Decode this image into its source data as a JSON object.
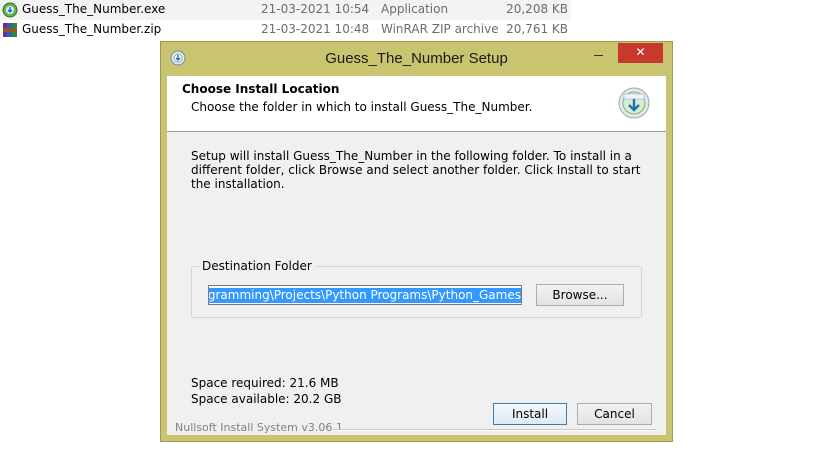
{
  "files": [
    {
      "name": "Guess_The_Number.exe",
      "date": "21-03-2021 10:54",
      "type": "Application",
      "size": "20,208 KB",
      "icon": "setup-app-icon"
    },
    {
      "name": "Guess_The_Number.zip",
      "date": "21-03-2021 10:48",
      "type": "WinRAR ZIP archive",
      "size": "20,761 KB",
      "icon": "winrar-archive-icon"
    }
  ],
  "window": {
    "title": "Guess_The_Number Setup",
    "close_glyph": "✕"
  },
  "header": {
    "title": "Choose Install Location",
    "subtitle": "Choose the folder in which to install Guess_The_Number."
  },
  "body": {
    "description": "Setup will install Guess_The_Number in the following folder. To install in a different folder, click Browse and select another folder. Click Install to start the installation.",
    "destination_label": "Destination Folder",
    "path_value": "C:\\Users\\Desktop\\Programming\\Projects\\Python Programs\\Python_Games",
    "path_visible": "esktop\\Programming\\Projects\\Python Programs\\Python_Games",
    "browse_label": "Browse...",
    "space_required": "Space required: 21.6 MB",
    "space_available": "Space available: 20.2 GB"
  },
  "footer": {
    "brand": "Nullsoft Install System v3.06.1",
    "install_label": "Install",
    "cancel_label": "Cancel"
  },
  "colors": {
    "titlebar": "#c9c46f",
    "close_button": "#c7392c",
    "selection": "#3399ff"
  }
}
